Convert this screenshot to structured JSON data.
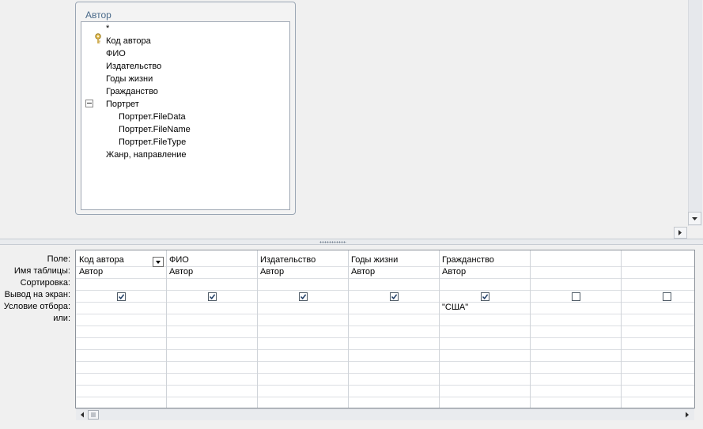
{
  "table": {
    "title": "Автор",
    "fields": [
      "*",
      "Код автора",
      "ФИО",
      "Издательство",
      "Годы жизни",
      "Гражданство",
      "Портрет",
      "Портрет.FileData",
      "Портрет.FileName",
      "Портрет.FileType",
      "Жанр, направление"
    ],
    "primary_key_field": "Код автора",
    "expanded_field": "Портрет"
  },
  "grid": {
    "row_labels": {
      "field": "Поле:",
      "table": "Имя таблицы:",
      "sort": "Сортировка:",
      "show": "Вывод на экран:",
      "criteria": "Условие отбора:",
      "or": "или:"
    },
    "columns": [
      {
        "field": "Код автора",
        "table": "Автор",
        "show": true,
        "criteria": ""
      },
      {
        "field": "ФИО",
        "table": "Автор",
        "show": true,
        "criteria": ""
      },
      {
        "field": "Издательство",
        "table": "Автор",
        "show": true,
        "criteria": ""
      },
      {
        "field": "Годы жизни",
        "table": "Автор",
        "show": true,
        "criteria": ""
      },
      {
        "field": "Гражданство",
        "table": "Автор",
        "show": true,
        "criteria": "\"США\""
      },
      {
        "field": "",
        "table": "",
        "show": false,
        "criteria": ""
      },
      {
        "field": "",
        "table": "",
        "show": false,
        "criteria": ""
      }
    ]
  },
  "icons": {
    "key": "key-icon",
    "collapse": "minus-box-icon",
    "dropdown": "chevron-down-icon",
    "scroll_down": "arrow-down-icon",
    "scroll_right": "arrow-right-icon",
    "scroll_left": "arrow-left-icon"
  }
}
